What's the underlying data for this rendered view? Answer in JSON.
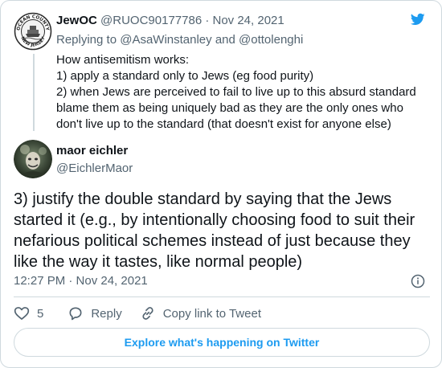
{
  "colors": {
    "brand": "#1d9bf0",
    "text": "#0f1419",
    "muted": "#536471",
    "border": "#cfd9de"
  },
  "parent_tweet": {
    "avatar_seal_text": [
      "OCEAN COUNTY",
      "NEW JERSEY"
    ],
    "author_name": "JewOC",
    "meta": "@RUOC90177786 · Nov 24, 2021",
    "reply_prefix": "Replying to ",
    "mention_1": "@AsaWinstanley",
    "reply_and": " and ",
    "mention_2": "@ottolenghi",
    "body_lines": [
      "How antisemitism works:",
      "1) apply a standard only to Jews (eg food purity)",
      "2) when Jews are perceived to fail to live up to this absurd standard",
      "blame them as being uniquely bad as they are the only ones who",
      "don't live up to the standard (that doesn't exist for anyone else)"
    ]
  },
  "main_tweet": {
    "author_name": "maor eichler",
    "author_handle": "@EichlerMaor",
    "body_lines": [
      "3) justify the double standard by saying that the Jews",
      "started it (e.g., by intentionally choosing food to suit their",
      "nefarious political schemes instead of just because they",
      "like the way it tastes, like normal people)"
    ],
    "timestamp": "12:27 PM · Nov 24, 2021"
  },
  "actions": {
    "like_count": "5",
    "reply_label": "Reply",
    "copy_link_label": "Copy link to Tweet"
  },
  "footer": {
    "explore_label": "Explore what's happening on Twitter"
  },
  "icons": [
    "twitter-bird-icon",
    "info-icon",
    "heart-icon",
    "reply-bubble-icon",
    "link-icon"
  ]
}
